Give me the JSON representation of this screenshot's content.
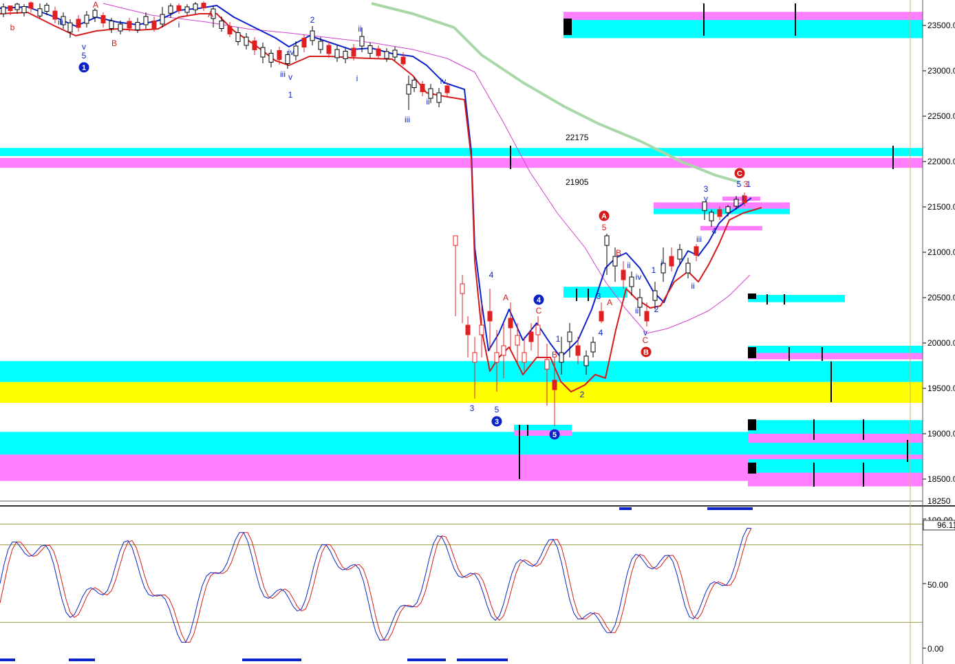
{
  "chart_data": [
    {
      "type": "candlestick",
      "title": "",
      "ylim": [
        18250,
        23750
      ],
      "y_ticks": [
        "23500.00",
        "23000.00",
        "22500.00",
        "22000.00",
        "21500.00",
        "21000.00",
        "20500.00",
        "20000.00",
        "19500.00",
        "19000.00",
        "18500.00"
      ],
      "y_tick_values": [
        23500,
        23000,
        22500,
        22000,
        21500,
        21000,
        20500,
        20000,
        19500,
        19000,
        18500
      ],
      "y_bottom_label": "18250",
      "grid": "off",
      "price_notes": [
        {
          "text": "22175",
          "y": 22175
        },
        {
          "text": "21905",
          "y": 21905
        }
      ],
      "zones": [
        {
          "y0": 23450,
          "y1": 23650,
          "color": "#ff7fff"
        },
        {
          "y0": 23360,
          "y1": 23560,
          "color": "#00ffff"
        },
        {
          "y0": 22060,
          "y1": 22150,
          "color": "#00ffff"
        },
        {
          "y0": 21930,
          "y1": 22040,
          "color": "#ff7fff"
        },
        {
          "y0": 19570,
          "y1": 19800,
          "color": "#00ffff"
        },
        {
          "y0": 19340,
          "y1": 19570,
          "color": "#ffff00"
        },
        {
          "y0": 18770,
          "y1": 19020,
          "color": "#00ffff"
        },
        {
          "y0": 18480,
          "y1": 18770,
          "color": "#ff7fff"
        },
        {
          "y0": 21470,
          "y1": 21550,
          "color": "#ff7fff"
        },
        {
          "y0": 21420,
          "y1": 21480,
          "color": "#00ffff"
        },
        {
          "y0": 21240,
          "y1": 21290,
          "color": "#ff7fff"
        },
        {
          "y0": 20500,
          "y1": 20620,
          "color": "#00ffff"
        },
        {
          "y0": 20470,
          "y1": 20510,
          "color": "#ff7fff"
        },
        {
          "y0": 20450,
          "y1": 20530,
          "color": "#00ffff"
        },
        {
          "y0": 19890,
          "y1": 19970,
          "color": "#00ffff"
        },
        {
          "y0": 19820,
          "y1": 19890,
          "color": "#ff7fff"
        },
        {
          "y0": 19000,
          "y1": 19150,
          "color": "#00ffff"
        },
        {
          "y0": 18900,
          "y1": 19000,
          "color": "#ff7fff"
        },
        {
          "y0": 18570,
          "y1": 18720,
          "color": "#00ffff"
        },
        {
          "y0": 18420,
          "y1": 18570,
          "color": "#ff7fff"
        }
      ],
      "wave_labels_blue": [
        "iii",
        "v",
        "5",
        "iii",
        "v",
        "1",
        "2",
        "ii",
        "i",
        "iv",
        "iii",
        "iv",
        "4",
        "3",
        "5",
        "ii",
        "3",
        "4",
        "2",
        "1",
        "i",
        "iv",
        "ii",
        "iii",
        "v",
        "2",
        "1",
        "i",
        "iii",
        "ii",
        "3",
        "v",
        "4",
        "5",
        "i",
        "1"
      ],
      "wave_labels_red": [
        "b",
        "A",
        "B",
        "A",
        "C",
        "B",
        "A",
        "5",
        "B",
        "A",
        "C",
        "3"
      ],
      "circled_blue": [
        "1",
        "3",
        "4",
        "5"
      ],
      "circled_red": [
        "A",
        "B",
        "C"
      ]
    },
    {
      "type": "line",
      "title": "",
      "ylim": [
        0,
        100
      ],
      "y_ticks": [
        "100.00",
        "50.00",
        "0.00"
      ],
      "current_value_label": "96.11",
      "reference_levels": [
        80,
        20
      ],
      "grid": "off",
      "series": [
        {
          "color": "#0a22c8",
          "style": "fast"
        },
        {
          "color": "#d41a1a",
          "style": "slow"
        }
      ]
    }
  ],
  "colors": {
    "blue_line": "#0a22c8",
    "red_line": "#d41a1a",
    "magenta_line": "#d040d0",
    "green_line": "#a8d8a8",
    "cyan": "#00ffff",
    "magenta": "#ff7fff",
    "yellow": "#ffff00"
  }
}
